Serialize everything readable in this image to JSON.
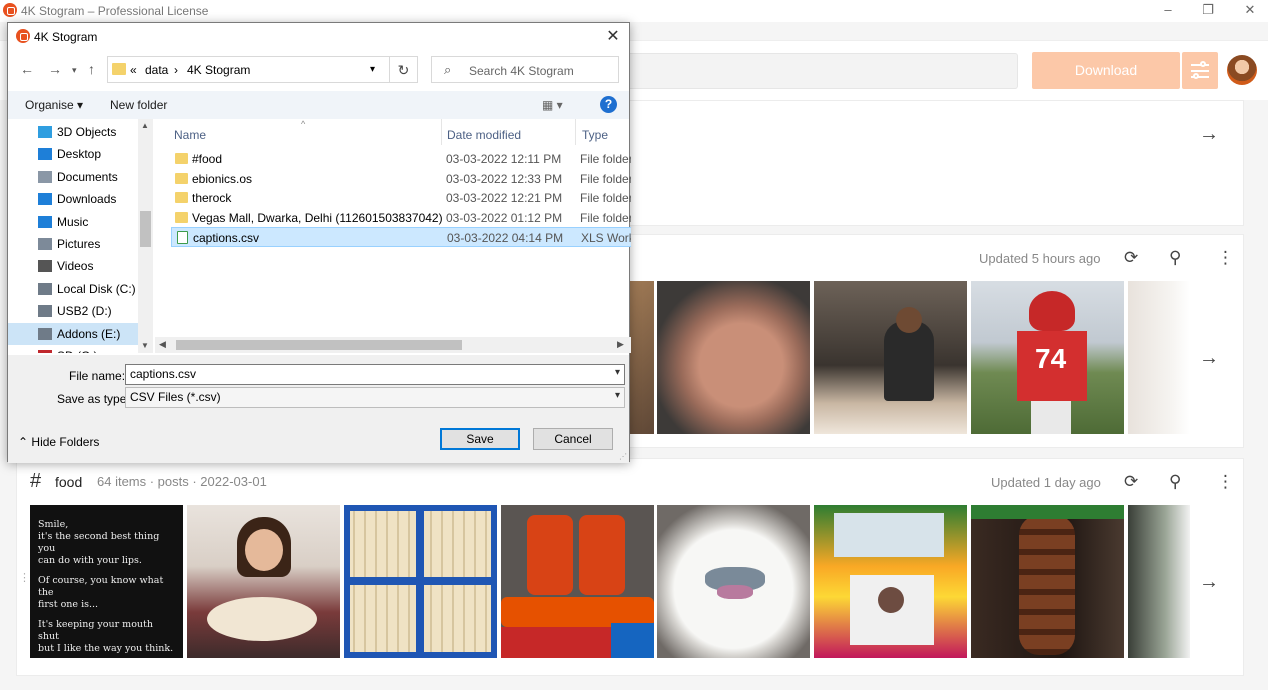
{
  "app": {
    "title": "4K Stogram – Professional License",
    "window_controls": {
      "minimize": "–",
      "restore": "❐",
      "close": "✕"
    }
  },
  "toolbar": {
    "download_label": "Download"
  },
  "cards": {
    "top": {
      "arrow": "→"
    },
    "middle": {
      "updated": "Updated 5 hours ago",
      "arrow": "→"
    },
    "food": {
      "hash": "#",
      "title": "food",
      "meta": "64 items · posts · 2022-03-01",
      "updated": "Updated 1 day ago",
      "arrow": "→",
      "quote": [
        "Smile,\nit's the second best thing you\ncan do with your lips.",
        "Of course, you know what the\nfirst one is...",
        "It's keeping your mouth shut\nbut I like the way you think."
      ]
    }
  },
  "dialog": {
    "title": "4K Stogram",
    "close": "✕",
    "address": {
      "prefix": "«",
      "crumbs": [
        "data",
        "4K Stogram"
      ],
      "separator": "›"
    },
    "search_placeholder": "Search 4K Stogram",
    "commands": {
      "organise": "Organise ▾",
      "new_folder": "New folder",
      "view": "▦ ▾",
      "help": "?"
    },
    "nav_items": [
      {
        "label": "3D Objects",
        "icon": "3d-objects-icon",
        "color": "#2f9ee0"
      },
      {
        "label": "Desktop",
        "icon": "desktop-icon",
        "color": "#1e7fd8"
      },
      {
        "label": "Documents",
        "icon": "documents-icon",
        "color": "#8a97a6"
      },
      {
        "label": "Downloads",
        "icon": "downloads-icon",
        "color": "#1e7fd8"
      },
      {
        "label": "Music",
        "icon": "music-icon",
        "color": "#1e7fd8"
      },
      {
        "label": "Pictures",
        "icon": "pictures-icon",
        "color": "#7d8a99"
      },
      {
        "label": "Videos",
        "icon": "videos-icon",
        "color": "#555555"
      },
      {
        "label": "Local Disk (C:)",
        "icon": "local-disk-icon",
        "color": "#6f7b88"
      },
      {
        "label": "USB2 (D:)",
        "icon": "usb-drive-icon",
        "color": "#6f7b88"
      },
      {
        "label": "Addons (E:)",
        "icon": "drive-icon",
        "color": "#6f7b88",
        "selected": true
      },
      {
        "label": "SD (G:)",
        "icon": "sd-card-icon",
        "color": "#c0282d"
      }
    ],
    "columns": {
      "name": "Name",
      "date": "Date modified",
      "type": "Type"
    },
    "files": [
      {
        "name": "#food",
        "date": "03-03-2022 12:11 PM",
        "type": "File folder",
        "kind": "folder"
      },
      {
        "name": "ebionics.os",
        "date": "03-03-2022 12:33 PM",
        "type": "File folder",
        "kind": "folder"
      },
      {
        "name": "therock",
        "date": "03-03-2022 12:21 PM",
        "type": "File folder",
        "kind": "folder"
      },
      {
        "name": "Vegas Mall, Dwarka, Delhi (112601503837042)",
        "date": "03-03-2022 01:12 PM",
        "type": "File folder",
        "kind": "folder"
      },
      {
        "name": "captions.csv",
        "date": "03-03-2022 04:14 PM",
        "type": "XLS Works",
        "kind": "csv",
        "selected": true
      }
    ],
    "file_name_label": "File name:",
    "file_name_value": "captions.csv",
    "save_type_label": "Save as type:",
    "save_type_value": "CSV Files (*.csv)",
    "hide_folders": "Hide Folders",
    "save_label": "Save",
    "cancel_label": "Cancel"
  }
}
